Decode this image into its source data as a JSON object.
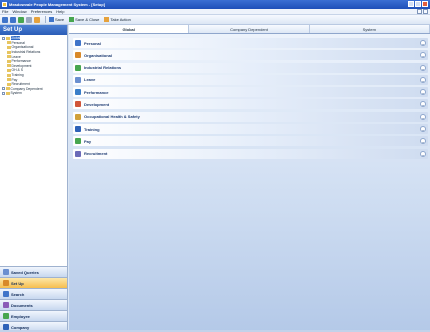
{
  "window": {
    "title": "Meadowvale People Management System - [Setup]"
  },
  "menu": {
    "items": [
      "File",
      "Window",
      "Preferences",
      "Help"
    ]
  },
  "toolbar": {
    "links": [
      {
        "label": "Save",
        "icon": "save-icon",
        "color": "#3f74c9"
      },
      {
        "label": "Save & Close",
        "icon": "save-close-icon",
        "color": "#47a64f"
      },
      {
        "label": "Take Action",
        "icon": "action-icon",
        "color": "#e6a23c"
      }
    ]
  },
  "left": {
    "header": "Set Up",
    "tree": [
      {
        "label": "Global",
        "level": 1,
        "selected": true
      },
      {
        "label": "Personal",
        "level": 2
      },
      {
        "label": "Organisational",
        "level": 2
      },
      {
        "label": "Industrial Relations",
        "level": 2
      },
      {
        "label": "Leave",
        "level": 2
      },
      {
        "label": "Performance",
        "level": 2
      },
      {
        "label": "Development",
        "level": 2
      },
      {
        "label": "OH & S",
        "level": 2
      },
      {
        "label": "Training",
        "level": 2
      },
      {
        "label": "Pay",
        "level": 2
      },
      {
        "label": "Recruitment",
        "level": 2
      },
      {
        "label": "Company Dependent",
        "level": 1
      },
      {
        "label": "System",
        "level": 1
      }
    ],
    "nav": [
      {
        "label": "Saved Queries",
        "color": "#6a8fd0",
        "active": false
      },
      {
        "label": "Set Up",
        "color": "#d8892a",
        "active": true
      },
      {
        "label": "Search",
        "color": "#3f74c9",
        "active": false
      },
      {
        "label": "Documents",
        "color": "#8a5bb8",
        "active": false
      },
      {
        "label": "Employee",
        "color": "#47a64f",
        "active": false
      },
      {
        "label": "Company",
        "color": "#2e62b8",
        "active": false
      }
    ]
  },
  "main": {
    "tabs": [
      {
        "label": "Global",
        "active": true
      },
      {
        "label": "Company Dependent",
        "active": false
      },
      {
        "label": "System",
        "active": false
      }
    ],
    "sections": [
      {
        "label": "Personal",
        "color": "#3f74c9"
      },
      {
        "label": "Organisational",
        "color": "#d8892a"
      },
      {
        "label": "Industrial Relations",
        "color": "#47a64f"
      },
      {
        "label": "Leave",
        "color": "#6a8fd0"
      },
      {
        "label": "Performance",
        "color": "#3a7ec9"
      },
      {
        "label": "Development",
        "color": "#d0553a"
      },
      {
        "label": "Occupational Health & Safety",
        "color": "#d0a03a"
      },
      {
        "label": "Training",
        "color": "#2e62b8"
      },
      {
        "label": "Pay",
        "color": "#47a64f"
      },
      {
        "label": "Recruitment",
        "color": "#6b6bb8"
      }
    ]
  }
}
